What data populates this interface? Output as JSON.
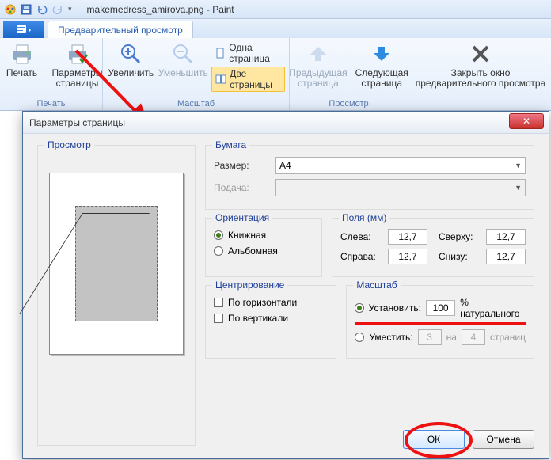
{
  "window": {
    "title": "makemedress_amirova.png - Paint"
  },
  "ribbon": {
    "tab_label": "Предварительный просмотр",
    "groups": {
      "print": {
        "label": "Печать",
        "print_btn": "Печать",
        "page_setup_btn": "Параметры\nстраницы"
      },
      "zoom": {
        "label": "Масштаб",
        "zoom_in": "Увеличить",
        "zoom_out": "Уменьшить",
        "one_page": "Одна страница",
        "two_pages": "Две страницы"
      },
      "view": {
        "label": "Просмотр",
        "prev_page": "Предыдущая\nстраница",
        "next_page": "Следующая\nстраница"
      },
      "close": {
        "label": "",
        "close_btn": "Закрыть окно\nпредварительного просмотра"
      }
    }
  },
  "dialog": {
    "title": "Параметры страницы",
    "preview_legend": "Просмотр",
    "paper": {
      "legend": "Бумага",
      "size_label": "Размер:",
      "size_value": "A4",
      "source_label": "Подача:"
    },
    "orientation": {
      "legend": "Ориентация",
      "portrait": "Книжная",
      "landscape": "Альбомная"
    },
    "margins": {
      "legend": "Поля (мм)",
      "left_label": "Слева:",
      "left_value": "12,7",
      "right_label": "Справа:",
      "right_value": "12,7",
      "top_label": "Сверху:",
      "top_value": "12,7",
      "bottom_label": "Снизу:",
      "bottom_value": "12,7"
    },
    "centering": {
      "legend": "Центрирование",
      "horizontal": "По горизонтали",
      "vertical": "По вертикали"
    },
    "scale": {
      "legend": "Масштаб",
      "set_label": "Установить:",
      "set_value": "100",
      "set_suffix": "% натурального",
      "fit_label": "Уместить:",
      "fit_w": "3",
      "fit_sep": "на",
      "fit_h": "4",
      "fit_suffix": "страниц"
    },
    "buttons": {
      "ok": "ОК",
      "cancel": "Отмена"
    }
  }
}
